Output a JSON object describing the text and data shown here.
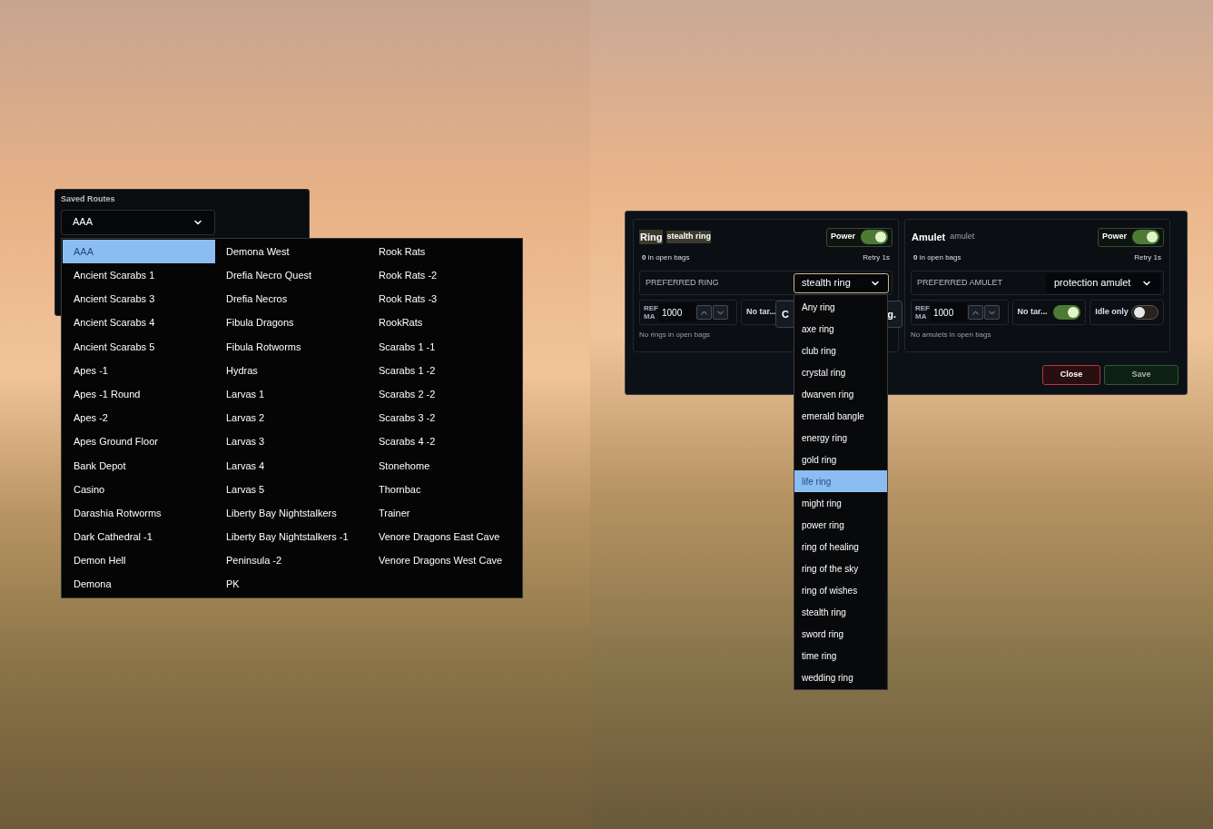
{
  "saved_routes": {
    "title": "Saved Routes",
    "value": "AAA",
    "expanded": true,
    "options": [
      {
        "label": "AAA",
        "selected": true
      },
      {
        "label": "Ancient Scarabs 1",
        "selected": false
      },
      {
        "label": "Ancient Scarabs 3",
        "selected": false
      },
      {
        "label": "Ancient Scarabs 4",
        "selected": false
      },
      {
        "label": "Ancient Scarabs 5",
        "selected": false
      },
      {
        "label": "Apes -1",
        "selected": false
      },
      {
        "label": "Apes -1 Round",
        "selected": false
      },
      {
        "label": "Apes -2",
        "selected": false
      },
      {
        "label": "Apes Ground Floor",
        "selected": false
      },
      {
        "label": "Bank Depot",
        "selected": false
      },
      {
        "label": "Casino",
        "selected": false
      },
      {
        "label": "Darashia Rotworms",
        "selected": false
      },
      {
        "label": "Dark Cathedral -1",
        "selected": false
      },
      {
        "label": "Demon Hell",
        "selected": false
      },
      {
        "label": "Demona",
        "selected": false
      },
      {
        "label": "Demona West",
        "selected": false
      },
      {
        "label": "Drefia Necro Quest",
        "selected": false
      },
      {
        "label": "Drefia Necros",
        "selected": false
      },
      {
        "label": "Fibula Dragons",
        "selected": false
      },
      {
        "label": "Fibula Rotworms",
        "selected": false
      },
      {
        "label": "Hydras",
        "selected": false
      },
      {
        "label": "Larvas 1",
        "selected": false
      },
      {
        "label": "Larvas 2",
        "selected": false
      },
      {
        "label": "Larvas 3",
        "selected": false
      },
      {
        "label": "Larvas 4",
        "selected": false
      },
      {
        "label": "Larvas 5",
        "selected": false
      },
      {
        "label": "Liberty Bay Nightstalkers",
        "selected": false
      },
      {
        "label": "Liberty Bay Nightstalkers -1",
        "selected": false
      },
      {
        "label": "Peninsula -2",
        "selected": false
      },
      {
        "label": "PK",
        "selected": false
      },
      {
        "label": "Rook Rats",
        "selected": false
      },
      {
        "label": "Rook Rats -2",
        "selected": false
      },
      {
        "label": "Rook Rats -3",
        "selected": false
      },
      {
        "label": "RookRats",
        "selected": false
      },
      {
        "label": "Scarabs 1 -1",
        "selected": false
      },
      {
        "label": "Scarabs 1 -2",
        "selected": false
      },
      {
        "label": "Scarabs 2 -2",
        "selected": false
      },
      {
        "label": "Scarabs 3 -2",
        "selected": false
      },
      {
        "label": "Scarabs 4 -2",
        "selected": false
      },
      {
        "label": "Stonehome",
        "selected": false
      },
      {
        "label": "Thornbac",
        "selected": false
      },
      {
        "label": "Trainer",
        "selected": false
      },
      {
        "label": "Venore Dragons East Cave",
        "selected": false
      },
      {
        "label": "Venore Dragons West Cave",
        "selected": false
      }
    ]
  },
  "modal": {
    "sections": [
      {
        "title": "Ring",
        "subtitle": "stealth ring",
        "highlighted": true,
        "power": {
          "label": "Power",
          "on": true
        },
        "count": "**0** in open bags",
        "retry": "Retry 1s",
        "preferred": {
          "label": "PREFERRED RING",
          "value": "stealth ring",
          "expanded": true,
          "options": [
            {
              "label": "Any ring",
              "highlighted": false
            },
            {
              "label": "axe ring",
              "highlighted": false
            },
            {
              "label": "club ring",
              "highlighted": false
            },
            {
              "label": "crystal ring",
              "highlighted": false
            },
            {
              "label": "dwarven ring",
              "highlighted": false
            },
            {
              "label": "emerald bangle",
              "highlighted": false
            },
            {
              "label": "energy ring",
              "highlighted": false
            },
            {
              "label": "gold ring",
              "highlighted": false
            },
            {
              "label": "life ring",
              "highlighted": true
            },
            {
              "label": "might ring",
              "highlighted": false
            },
            {
              "label": "power ring",
              "highlighted": false
            },
            {
              "label": "ring of healing",
              "highlighted": false
            },
            {
              "label": "ring of the sky",
              "highlighted": false
            },
            {
              "label": "ring of wishes",
              "highlighted": false
            },
            {
              "label": "stealth ring",
              "highlighted": false
            },
            {
              "label": "sword ring",
              "highlighted": false
            },
            {
              "label": "time ring",
              "highlighted": false
            },
            {
              "label": "wedding ring",
              "highlighted": false
            }
          ]
        },
        "refill": {
          "label_lines": [
            "REF",
            "MA"
          ],
          "value": "1000"
        },
        "toggles": [
          {
            "label": "No tar..."
          }
        ],
        "overlay_button": {
          "left_text": "C",
          "right_text": "g."
        },
        "note": "No rings in open bags"
      },
      {
        "title": "Amulet",
        "subtitle": "amulet",
        "highlighted": false,
        "power": {
          "label": "Power",
          "on": true
        },
        "count": "**0** in open bags",
        "retry": "Retry 1s",
        "preferred": {
          "label": "PREFERRED AMULET",
          "value": "protection amulet",
          "expanded": false
        },
        "refill": {
          "label_lines": [
            "REF",
            "MA"
          ],
          "value": "1000"
        },
        "toggles": [
          {
            "label": "No tar...",
            "on": true
          },
          {
            "label": "Idle only",
            "on": false
          }
        ],
        "note": "No amulets in open bags"
      }
    ],
    "buttons": [
      {
        "label": "Close",
        "kind": "danger"
      },
      {
        "label": "Save",
        "kind": "primary"
      }
    ]
  }
}
